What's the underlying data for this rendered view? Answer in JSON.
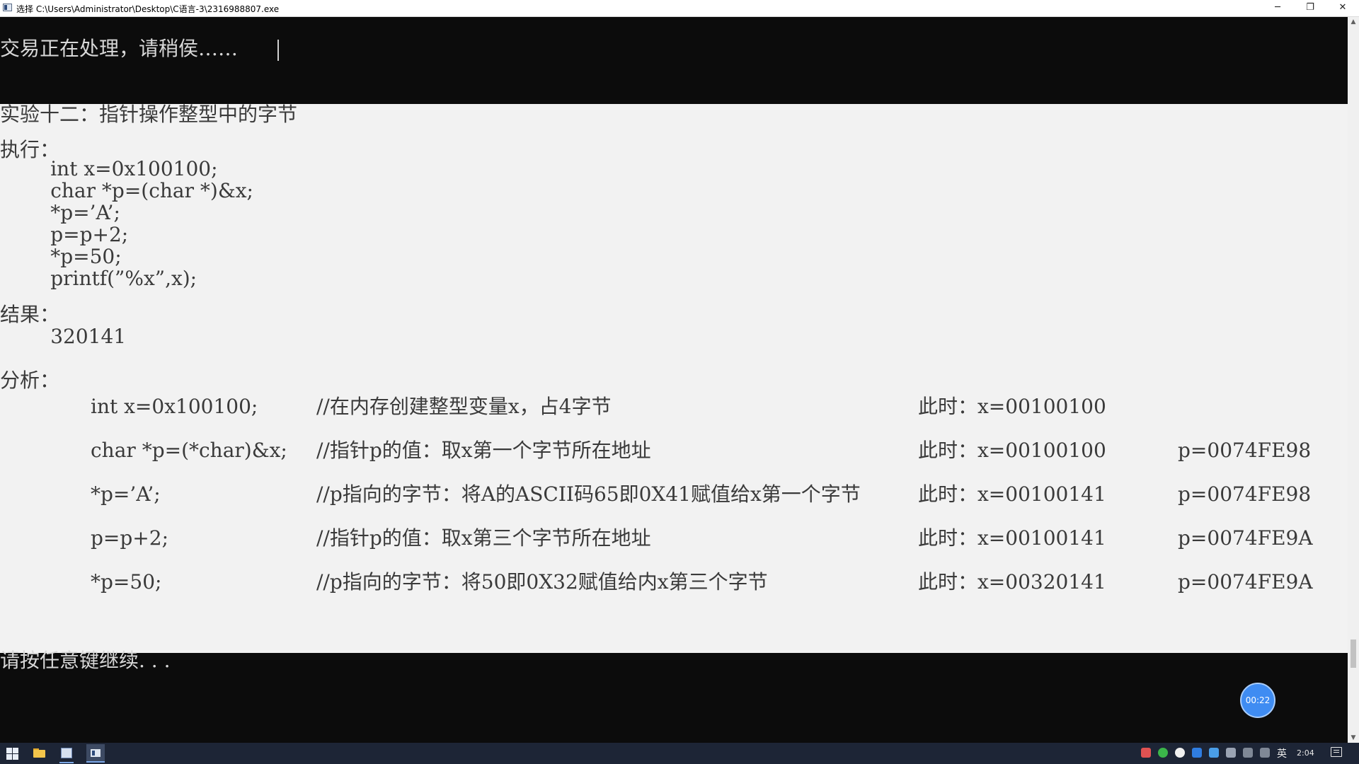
{
  "window": {
    "title": "选择 C:\\Users\\Administrator\\Desktop\\C语言-3\\2316988807.exe",
    "minimize_glyph": "─",
    "maximize_glyph": "❐",
    "close_glyph": "✕"
  },
  "console": {
    "processing_line": "交易正在处理，请稍侯……",
    "lines": [
      "实验十二：指针操作整型中的字节",
      "执行：",
      "        int x=0x100100;",
      "        char *p=(char *)&x;",
      "        *p=’A’;",
      "        p=p+2;",
      "        *p=50;",
      "        printf(”%x”,x);",
      "结果：",
      "        320141",
      "分析："
    ],
    "analysis": [
      {
        "code": "int x=0x100100;",
        "comment": "//在内存创建整型变量x，占4字节",
        "state_x": "此时：x=00100100",
        "state_p": ""
      },
      {
        "code": "char *p=(*char)&x;",
        "comment": "//指针p的值：取x第一个字节所在地址",
        "state_x": "此时：x=00100100",
        "state_p": "p=0074FE98"
      },
      {
        "code": "*p=’A’;",
        "comment": "//p指向的字节：将A的ASCII码65即0X41赋值给x第一个字节",
        "state_x": "此时：x=00100141",
        "state_p": "p=0074FE98"
      },
      {
        "code": "p=p+2;",
        "comment": "//指针p的值：取x第三个字节所在地址",
        "state_x": "此时：x=00100141",
        "state_p": "p=0074FE9A"
      },
      {
        "code": "*p=50;",
        "comment": "//p指向的字节：将50即0X32赋值给内x第三个字节",
        "state_x": "此时：x=00320141",
        "state_p": "p=0074FE9A"
      }
    ],
    "pause_prompt": "请按任意键继续. . ."
  },
  "timer_badge": "00:22",
  "taskbar": {
    "language": "英",
    "clock": "2:04"
  },
  "icons": {
    "start": "windows-start-icon",
    "explorer": "file-explorer-icon",
    "app": "app-window-icon",
    "console": "console-window-icon"
  },
  "colors": {
    "console_bg": "#0c0c0c",
    "panel_bg": "#f2f2f2",
    "taskbar_bg": "#1d2536",
    "timer_bg": "#3f8cf2"
  }
}
